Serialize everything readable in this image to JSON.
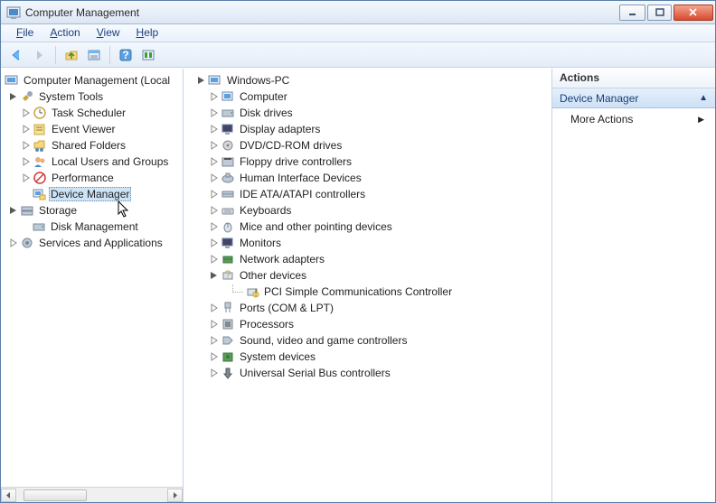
{
  "window": {
    "title": "Computer Management"
  },
  "menus": [
    "File",
    "Action",
    "View",
    "Help"
  ],
  "leftTree": {
    "root": "Computer Management (Local",
    "systools": {
      "label": "System Tools",
      "items": [
        "Task Scheduler",
        "Event Viewer",
        "Shared Folders",
        "Local Users and Groups",
        "Performance",
        "Device Manager"
      ]
    },
    "storage": {
      "label": "Storage",
      "items": [
        "Disk Management"
      ]
    },
    "services": "Services and Applications"
  },
  "midTree": {
    "root": "Windows-PC",
    "items": [
      "Computer",
      "Disk drives",
      "Display adapters",
      "DVD/CD-ROM drives",
      "Floppy drive controllers",
      "Human Interface Devices",
      "IDE ATA/ATAPI controllers",
      "Keyboards",
      "Mice and other pointing devices",
      "Monitors",
      "Network adapters",
      "Other devices",
      "PCI Simple Communications Controller",
      "Ports (COM & LPT)",
      "Processors",
      "Sound, video and game controllers",
      "System devices",
      "Universal Serial Bus controllers"
    ]
  },
  "actions": {
    "header": "Actions",
    "selected": "Device Manager",
    "more": "More Actions"
  }
}
